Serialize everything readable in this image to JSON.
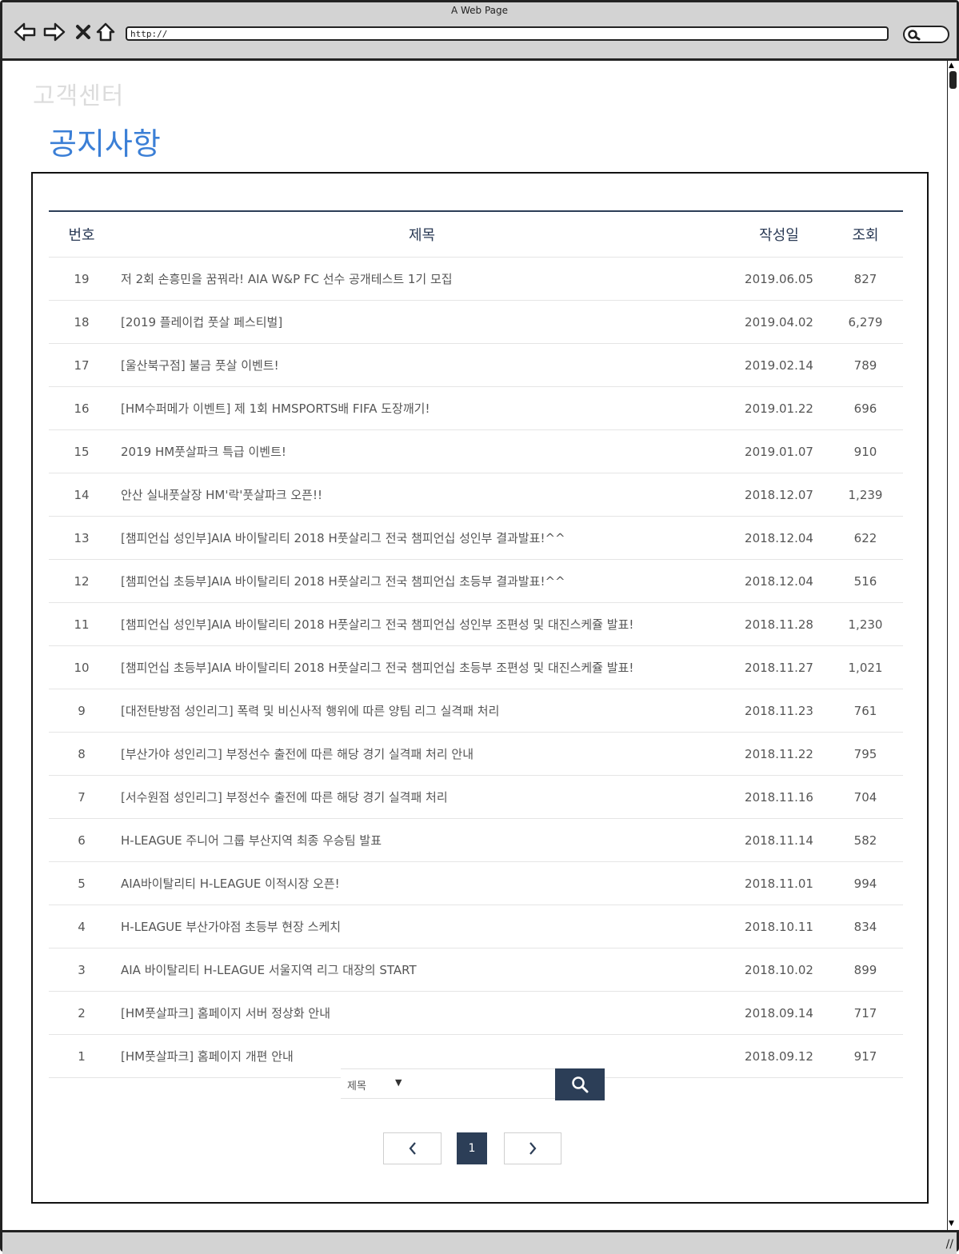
{
  "browser": {
    "window_title": "A Web Page",
    "address": "http://"
  },
  "page": {
    "section_label": "고객센터",
    "title": "공지사항"
  },
  "table": {
    "headers": {
      "no": "번호",
      "title": "제목",
      "date": "작성일",
      "views": "조회"
    },
    "rows": [
      {
        "no": "19",
        "title": "저 2회 손흥민을 꿈꿔라! AIA W&P FC 선수 공개테스트 1기 모집",
        "date": "2019.06.05",
        "views": "827"
      },
      {
        "no": "18",
        "title": "[2019 플레이컵 풋살 페스티벌]",
        "date": "2019.04.02",
        "views": "6,279"
      },
      {
        "no": "17",
        "title": "[울산북구점] 불금 풋살 이벤트!",
        "date": "2019.02.14",
        "views": "789"
      },
      {
        "no": "16",
        "title": "[HM수퍼메가 이벤트] 제 1회 HMSPORTS배 FIFA 도장깨기!",
        "date": "2019.01.22",
        "views": "696"
      },
      {
        "no": "15",
        "title": "2019 HM풋살파크 특급 이벤트!",
        "date": "2019.01.07",
        "views": "910"
      },
      {
        "no": "14",
        "title": "안산 실내풋살장 HM'락'풋살파크 오픈!!",
        "date": "2018.12.07",
        "views": "1,239"
      },
      {
        "no": "13",
        "title": "[챔피언십 성인부]AIA 바이탈리티 2018 H풋살리그 전국 챔피언십 성인부 결과발표!^^",
        "date": "2018.12.04",
        "views": "622"
      },
      {
        "no": "12",
        "title": "[챔피언십 초등부]AIA 바이탈리티 2018 H풋살리그 전국 챔피언십 초등부 결과발표!^^",
        "date": "2018.12.04",
        "views": "516"
      },
      {
        "no": "11",
        "title": "[챔피언십 성인부]AIA 바이탈리티 2018 H풋살리그 전국 챔피언십 성인부 조편성 및 대진스케쥴 발표!",
        "date": "2018.11.28",
        "views": "1,230"
      },
      {
        "no": "10",
        "title": "[챔피언십 초등부]AIA 바이탈리티 2018 H풋살리그 전국 챔피언십 초등부 조편성 및 대진스케쥴 발표!",
        "date": "2018.11.27",
        "views": "1,021"
      },
      {
        "no": "9",
        "title": "[대전탄방점 성인리그] 폭력 및 비신사적 행위에 따른 양팀 리그 실격패 처리",
        "date": "2018.11.23",
        "views": "761"
      },
      {
        "no": "8",
        "title": "[부산가야 성인리그] 부정선수 출전에 따른 해당 경기 실격패 처리 안내",
        "date": "2018.11.22",
        "views": "795"
      },
      {
        "no": "7",
        "title": "[서수원점 성인리그] 부정선수 출전에 따른 해당 경기 실격패 처리",
        "date": "2018.11.16",
        "views": "704"
      },
      {
        "no": "6",
        "title": "H-LEAGUE 주니어 그룹 부산지역 최종 우승팀 발표",
        "date": "2018.11.14",
        "views": "582"
      },
      {
        "no": "5",
        "title": "AIA바이탈리티 H-LEAGUE 이적시장 오픈!",
        "date": "2018.11.01",
        "views": "994"
      },
      {
        "no": "4",
        "title": "H-LEAGUE 부산가야점 초등부 현장 스케치",
        "date": "2018.10.11",
        "views": "834"
      },
      {
        "no": "3",
        "title": "AIA 바이탈리티 H-LEAGUE 서울지역 리그 대장의 START",
        "date": "2018.10.02",
        "views": "899"
      },
      {
        "no": "2",
        "title": "[HM풋살파크] 홈페이지 서버 정상화 안내",
        "date": "2018.09.14",
        "views": "717"
      },
      {
        "no": "1",
        "title": "[HM풋살파크] 홈페이지 개편 안내",
        "date": "2018.09.12",
        "views": "917"
      }
    ]
  },
  "search": {
    "select_value": "제목",
    "button_icon": "search-icon"
  },
  "pagination": {
    "current_page": "1",
    "prev_icon": "chevron-left-icon",
    "next_icon": "chevron-right-icon"
  },
  "colors": {
    "title_blue": "#3b7fd6",
    "navy": "#2c3e57",
    "muted": "#9a9a9a"
  }
}
